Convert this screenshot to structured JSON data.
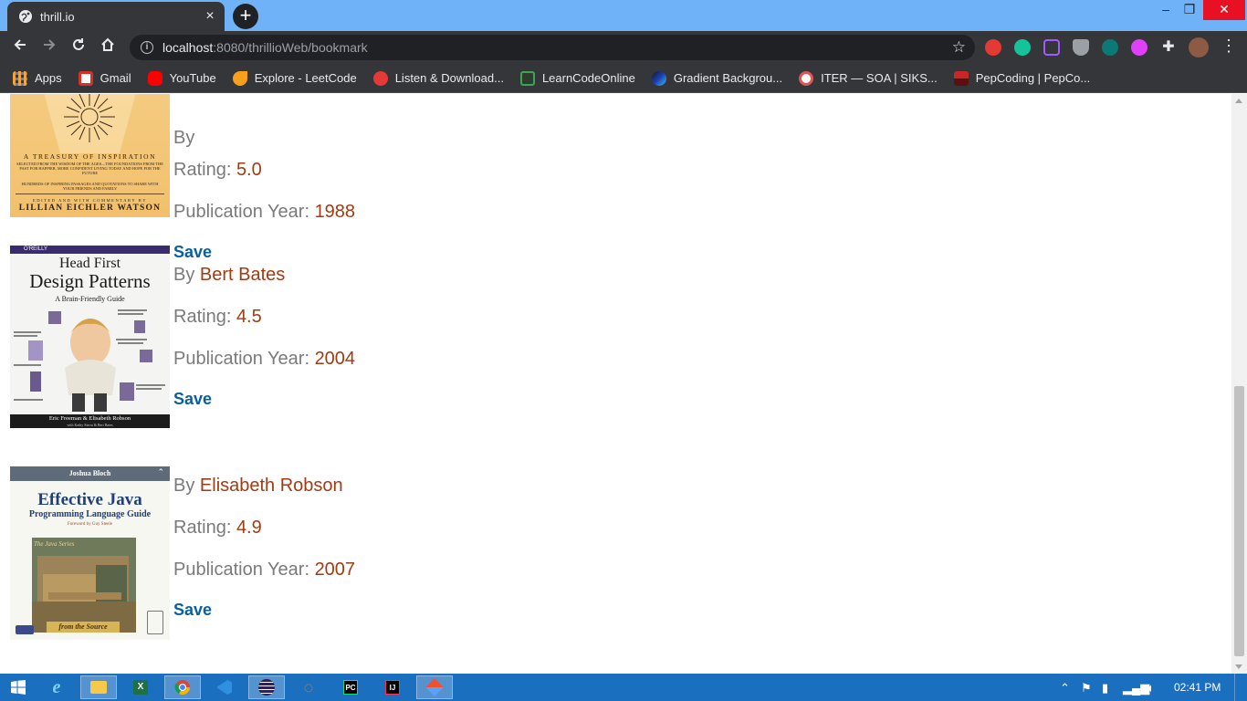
{
  "browser": {
    "tab_title": "thrill.io",
    "tab_close": "×",
    "new_tab": "+",
    "url_host": "localhost",
    "url_path": ":8080/thrillioWeb/bookmark",
    "window_controls": [
      "–",
      "❐",
      "✕"
    ]
  },
  "bookmarks": [
    {
      "label": "Apps",
      "icon": "apps-grid-icon",
      "color": "#f2a33a"
    },
    {
      "label": "Gmail",
      "icon": "gmail-icon",
      "color": "#d93025"
    },
    {
      "label": "YouTube",
      "icon": "youtube-icon",
      "color": "#ff0000"
    },
    {
      "label": "Explore - LeetCode",
      "icon": "leetcode-icon",
      "color": "#f89f1b"
    },
    {
      "label": "Listen & Download...",
      "icon": "music-icon",
      "color": "#e53935"
    },
    {
      "label": "LearnCodeOnline",
      "icon": "lco-icon",
      "color": "#3aa655"
    },
    {
      "label": "Gradient Backgrou...",
      "icon": "gradient-icon",
      "color": "#1e40af"
    },
    {
      "label": "ITER — SOA | SIKS...",
      "icon": "iter-icon",
      "color": "#e05656"
    },
    {
      "label": "PepCoding | PepCo...",
      "icon": "pepcoding-icon",
      "color": "#c62828"
    }
  ],
  "books": [
    {
      "author_prefix": "By ",
      "author": "",
      "rating_label": "Rating: ",
      "rating": "5.0",
      "year_label": "Publication Year: ",
      "year": "1988",
      "save_label": "Save",
      "cover": {
        "subtitle": "A TREASURY OF INSPIRATION",
        "blurb": "SELECTED FROM THE WISDOM OF THE AGES—THE FOUNDATIONS FROM THE PAST FOR HAPPIER, MORE CONFIDENT LIVING TODAY AND HOPE FOR THE FUTURE",
        "blurb2": "HUNDREDS OF INSPIRING PASSAGES AND QUOTATIONS TO SHARE WITH YOUR FRIENDS AND FAMILY",
        "editor_line": "EDITED AND WITH COMMENTARY BY",
        "editor": "LILLIAN EICHLER WATSON"
      }
    },
    {
      "author_prefix": "By ",
      "author": "Bert Bates",
      "rating_label": "Rating: ",
      "rating": "4.5",
      "year_label": "Publication Year: ",
      "year": "2004",
      "save_label": "Save",
      "cover": {
        "publisher": "O'REILLY",
        "title1": "Head First",
        "title2": "Design Patterns",
        "subtitle": "A Brain-Friendly Guide",
        "authors": "Eric Freeman & Elisabeth Robson",
        "with": "with Kathy Sierra & Bert Bates"
      }
    },
    {
      "author_prefix": "By ",
      "author": "Elisabeth Robson",
      "rating_label": "Rating: ",
      "rating": "4.9",
      "year_label": "Publication Year: ",
      "year": "2007",
      "save_label": "Save",
      "cover": {
        "author": "Joshua Bloch",
        "title": "Effective Java",
        "subtitle": "Programming Language Guide",
        "foreword": "Foreword by Guy Steele",
        "series": "The Java Series",
        "tagline": "from the Source"
      }
    }
  ],
  "taskbar": {
    "clock": "02:41 PM",
    "items": [
      "start-icon",
      "ie-icon",
      "file-explorer-icon",
      "excel-icon",
      "chrome-icon",
      "vscode-icon",
      "eclipse-icon",
      "jupyter-icon",
      "pycharm-icon",
      "intellij-icon",
      "git-icon"
    ]
  }
}
